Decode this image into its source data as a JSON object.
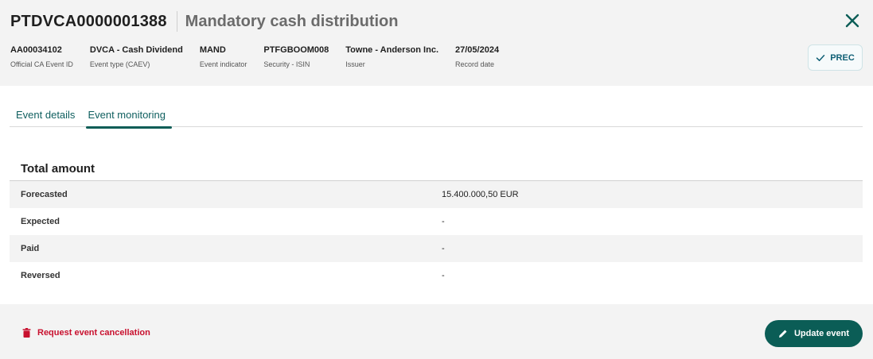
{
  "header": {
    "event_id": "PTDVCA0000001388",
    "title": "Mandatory cash distribution",
    "meta": [
      {
        "value": "AA00034102",
        "label": "Official CA Event ID"
      },
      {
        "value": "DVCA - Cash Dividend",
        "label": "Event type (CAEV)"
      },
      {
        "value": "MAND",
        "label": "Event indicator"
      },
      {
        "value": "PTFGBOOM008",
        "label": "Security - ISIN"
      },
      {
        "value": "Towne - Anderson Inc.",
        "label": "Issuer"
      },
      {
        "value": "27/05/2024",
        "label": "Record date"
      }
    ],
    "status_button": "PREC"
  },
  "tabs": [
    {
      "label": "Event details",
      "active": false
    },
    {
      "label": "Event monitoring",
      "active": true
    }
  ],
  "total_amount": {
    "title": "Total amount",
    "rows": [
      {
        "label": "Forecasted",
        "value": "15.400.000,50 EUR"
      },
      {
        "label": "Expected",
        "value": "-"
      },
      {
        "label": "Paid",
        "value": "-"
      },
      {
        "label": "Reversed",
        "value": "-"
      }
    ]
  },
  "footer": {
    "cancel_label": "Request event cancellation",
    "update_label": "Update event"
  },
  "colors": {
    "primary": "#0b5d56",
    "danger": "#c8102e",
    "accent_text": "#0f5f75"
  },
  "icons": {
    "close": "close-icon",
    "status": "check-icon",
    "cancel": "trash-icon",
    "update": "pencil-icon"
  }
}
